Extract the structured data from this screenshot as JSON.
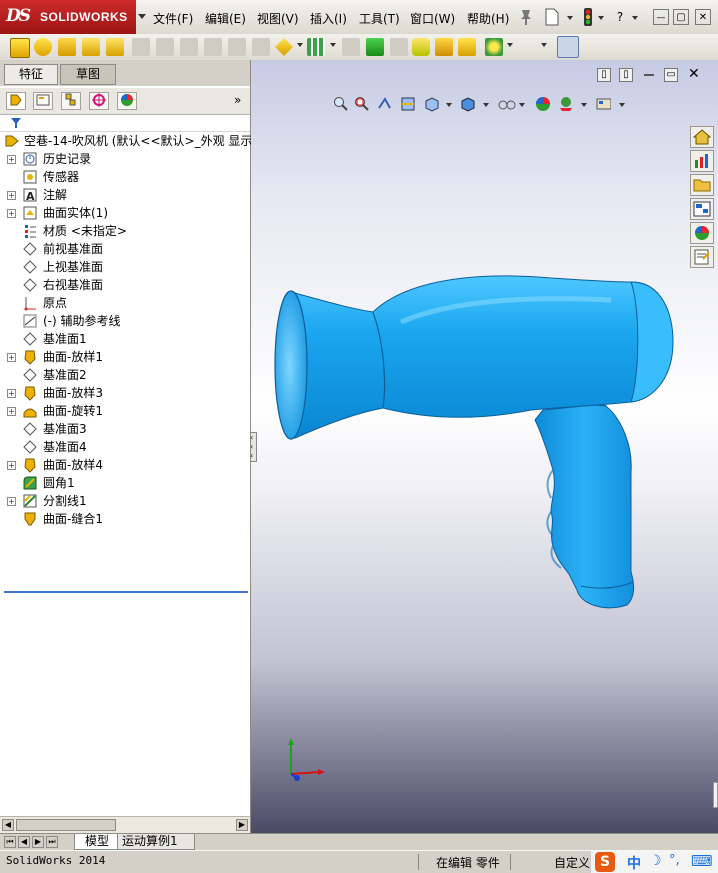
{
  "app": {
    "logo_ds": "DS",
    "logo_name": "SOLIDWORKS"
  },
  "menu": [
    "文件(F)",
    "编辑(E)",
    "视图(V)",
    "插入(I)",
    "工具(T)",
    "窗口(W)",
    "帮助(H)"
  ],
  "title_controls": {
    "help": "?",
    "min": "—",
    "restore": "▢",
    "close": "✕"
  },
  "tabs": {
    "features": "特征",
    "sketch": "草图"
  },
  "tree": {
    "root": "空巷-14-吹风机  (默认<<默认>_外观 显示",
    "items": [
      {
        "label": "历史记录",
        "expand": true,
        "icon": "history-icon"
      },
      {
        "label": "传感器",
        "expand": false,
        "icon": "sensor-icon"
      },
      {
        "label": "注解",
        "expand": true,
        "icon": "annotation-icon"
      },
      {
        "label": "曲面实体(1)",
        "expand": true,
        "icon": "surface-body-icon"
      },
      {
        "label": "材质 <未指定>",
        "expand": false,
        "icon": "material-icon"
      },
      {
        "label": "前视基准面",
        "expand": false,
        "icon": "plane-icon"
      },
      {
        "label": "上视基准面",
        "expand": false,
        "icon": "plane-icon"
      },
      {
        "label": "右视基准面",
        "expand": false,
        "icon": "plane-icon"
      },
      {
        "label": "原点",
        "expand": false,
        "icon": "origin-icon"
      },
      {
        "label": "(-) 辅助参考线",
        "expand": false,
        "icon": "sketch-icon"
      },
      {
        "label": "基准面1",
        "expand": false,
        "icon": "plane-icon"
      },
      {
        "label": "曲面-放样1",
        "expand": true,
        "icon": "loft-icon"
      },
      {
        "label": "基准面2",
        "expand": false,
        "icon": "plane-icon"
      },
      {
        "label": "曲面-放样3",
        "expand": true,
        "icon": "loft-icon"
      },
      {
        "label": "曲面-旋转1",
        "expand": true,
        "icon": "revolve-icon"
      },
      {
        "label": "基准面3",
        "expand": false,
        "icon": "plane-icon"
      },
      {
        "label": "基准面4",
        "expand": false,
        "icon": "plane-icon"
      },
      {
        "label": "曲面-放样4",
        "expand": true,
        "icon": "loft-icon"
      },
      {
        "label": "圆角1",
        "expand": false,
        "icon": "fillet-icon"
      },
      {
        "label": "分割线1",
        "expand": true,
        "icon": "split-line-icon"
      },
      {
        "label": "曲面-缝合1",
        "expand": false,
        "icon": "knit-icon"
      }
    ]
  },
  "bottom_tabs": {
    "model": "模型",
    "motion": "运动算例1"
  },
  "status": {
    "left": "SolidWorks 2014",
    "mode": "在编辑 零件",
    "custom": "自定义"
  },
  "ime": {
    "logo": "S",
    "lang": "中",
    "moon": "☽",
    "dot": "°,",
    "kb": "⌨"
  },
  "colors": {
    "model_blue": "#1a9fe6",
    "logo_red": "#c42020",
    "accent": "#3b78c9"
  }
}
